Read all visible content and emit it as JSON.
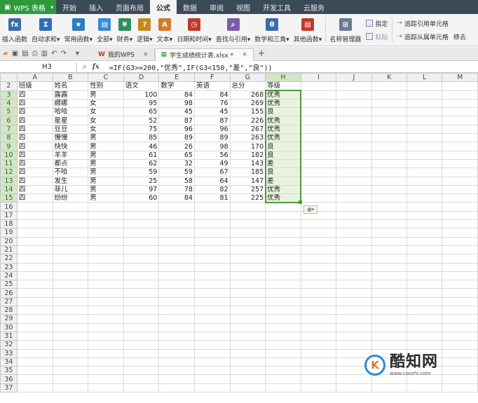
{
  "app": {
    "name": "WPS 表格"
  },
  "menu": [
    "开始",
    "插入",
    "页面布局",
    "公式",
    "数据",
    "审阅",
    "视图",
    "开发工具",
    "云服务"
  ],
  "menu_active_index": 3,
  "ribbon": {
    "buttons": [
      {
        "label": "插入函数",
        "icon": "fx-icon",
        "glyph": "fx",
        "color": "#3a6ea5"
      },
      {
        "label": "自动求和▾",
        "icon": "sigma-icon",
        "glyph": "Σ",
        "color": "#2f6fb7"
      },
      {
        "label": "常用函数▾",
        "icon": "star-book-icon",
        "glyph": "★",
        "color": "#2a7fc1"
      },
      {
        "label": "全部▾",
        "icon": "book-icon",
        "glyph": "▤",
        "color": "#3a8ad6"
      },
      {
        "label": "财务▾",
        "icon": "finance-icon",
        "glyph": "¥",
        "color": "#2f8f5a"
      },
      {
        "label": "逻辑▾",
        "icon": "logic-icon",
        "glyph": "?",
        "color": "#c28a1e"
      },
      {
        "label": "文本▾",
        "icon": "text-icon",
        "glyph": "A",
        "color": "#d47b2a"
      },
      {
        "label": "日期和时间▾",
        "icon": "clock-icon",
        "glyph": "◷",
        "color": "#c0392b"
      },
      {
        "label": "查找与引用▾",
        "icon": "lookup-icon",
        "glyph": "⌕",
        "color": "#7b5ea7"
      },
      {
        "label": "数学和三角▾",
        "icon": "math-icon",
        "glyph": "θ",
        "color": "#3a6ea5"
      },
      {
        "label": "其他函数▾",
        "icon": "more-func-icon",
        "glyph": "▤",
        "color": "#c0392b"
      },
      {
        "label": "名称管理器",
        "icon": "name-manager-icon",
        "glyph": "⊞",
        "color": "#6b7a8f"
      }
    ],
    "small": [
      {
        "label": "指定",
        "dim": false
      },
      {
        "label": "粘贴",
        "dim": true
      }
    ],
    "trace": [
      {
        "label": "追踪引用单元格"
      },
      {
        "label": "追踪从属单元格"
      }
    ],
    "trace_extra": "移去"
  },
  "doc_tabs": [
    {
      "label": "我的WPS",
      "active": false
    },
    {
      "label": "学生成绩统计表.xlsx *",
      "active": true
    }
  ],
  "formula_bar": {
    "name_box": "H3",
    "fx_label": "fx",
    "formula": "=IF(G3>=200,\"优秀\",IF(G3<150,\"差\",\"良\"))"
  },
  "columns": [
    "A",
    "B",
    "C",
    "D",
    "E",
    "F",
    "G",
    "H",
    "I",
    "J",
    "K",
    "L",
    "M"
  ],
  "headers": [
    "班级",
    "姓名",
    "性别",
    "语文",
    "数学",
    "英语",
    "总分",
    "等级"
  ],
  "rows": [
    [
      "四",
      "露露",
      "男",
      "100",
      "84",
      "84",
      "268",
      "优秀"
    ],
    [
      "四",
      "娜娜",
      "女",
      "95",
      "98",
      "76",
      "269",
      "优秀"
    ],
    [
      "四",
      "哈哈",
      "女",
      "65",
      "45",
      "45",
      "155",
      "良"
    ],
    [
      "四",
      "星星",
      "女",
      "52",
      "87",
      "87",
      "226",
      "优秀"
    ],
    [
      "四",
      "豆豆",
      "女",
      "75",
      "96",
      "96",
      "267",
      "优秀"
    ],
    [
      "四",
      "慢慢",
      "男",
      "85",
      "89",
      "89",
      "263",
      "优秀"
    ],
    [
      "四",
      "快快",
      "男",
      "46",
      "26",
      "98",
      "170",
      "良"
    ],
    [
      "四",
      "羊羊",
      "男",
      "61",
      "65",
      "56",
      "182",
      "良"
    ],
    [
      "四",
      "都点",
      "男",
      "62",
      "32",
      "49",
      "143",
      "差"
    ],
    [
      "四",
      "不哈",
      "男",
      "59",
      "59",
      "67",
      "185",
      "良"
    ],
    [
      "四",
      "发生",
      "男",
      "25",
      "58",
      "64",
      "147",
      "差"
    ],
    [
      "四",
      "菲儿",
      "男",
      "97",
      "78",
      "82",
      "257",
      "优秀"
    ],
    [
      "四",
      "纷纷",
      "男",
      "60",
      "84",
      "81",
      "225",
      "优秀"
    ]
  ],
  "empty_row_start": 16,
  "empty_row_end": 37,
  "watermark": {
    "title": "酷知网",
    "url": "www.coozhi.com",
    "logo_letter": "K"
  },
  "colors": {
    "accent_green": "#4b9b3a",
    "menubar": "#3c4a57",
    "app_green": "#2e9a3e"
  }
}
